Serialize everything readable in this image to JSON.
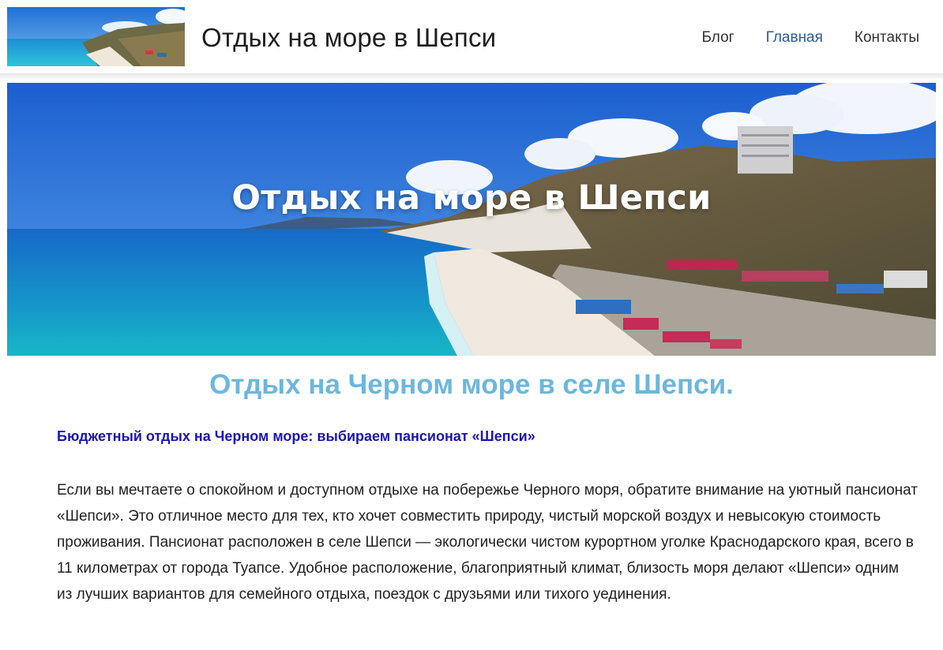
{
  "header": {
    "site_title": "Отдых на море в Шепси",
    "nav": {
      "blog": "Блог",
      "home": "Главная",
      "contacts": "Контакты"
    }
  },
  "hero": {
    "title": "Отдых на море в Шепси"
  },
  "content": {
    "heading": "Отдых на Черном море в селе Шепси.",
    "subheading": "Бюджетный отдых на Черном море: выбираем пансионат «Шепси»",
    "paragraph": "Если вы мечтаете о спокойном и доступном отдыхе на побережье Черного моря, обратите внимание на уютный пансионат «Шепси». Это отличное место для тех, кто хочет совместить природу, чистый морской воздух и невысокую стоимость проживания. Пансионат расположен в селе Шепси — экологически чистом курортном уголке Краснодарского края, всего в 11 километрах от города Туапсе. Удобное расположение, благоприятный климат, близость моря делают «Шепси» одним из лучших вариантов для семейного отдыха, поездок с друзьями или тихого уединения."
  },
  "colors": {
    "nav_active": "#2a5d9a",
    "heading": "#6cb7dc",
    "subheading_link": "#1a15b8"
  }
}
